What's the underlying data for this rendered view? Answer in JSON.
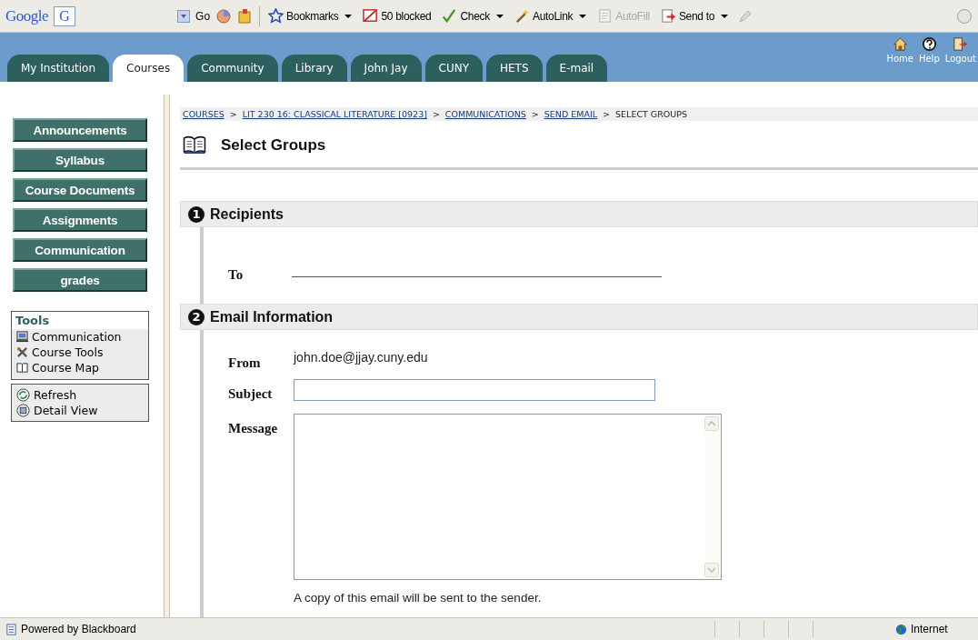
{
  "browser_toolbar": {
    "logo": "Google",
    "search_box": {
      "letter": "G"
    },
    "go": "Go",
    "items": [
      {
        "label": "Bookmarks",
        "kind": "star",
        "dropdown": true,
        "disabled": false
      },
      {
        "label": "50 blocked",
        "kind": "popup",
        "dropdown": false,
        "disabled": false
      },
      {
        "label": "Check",
        "kind": "spell",
        "dropdown": true,
        "disabled": false
      },
      {
        "label": "AutoLink",
        "kind": "wand",
        "dropdown": true,
        "disabled": false
      },
      {
        "label": "AutoFill",
        "kind": "form",
        "dropdown": false,
        "disabled": true
      },
      {
        "label": "Send to",
        "kind": "send",
        "dropdown": true,
        "disabled": false
      }
    ]
  },
  "tabs": [
    {
      "label": "My Institution",
      "selected": false
    },
    {
      "label": "Courses",
      "selected": true
    },
    {
      "label": "Community",
      "selected": false
    },
    {
      "label": "Library",
      "selected": false
    },
    {
      "label": "John Jay",
      "selected": false
    },
    {
      "label": "CUNY",
      "selected": false
    },
    {
      "label": "HETS",
      "selected": false
    },
    {
      "label": "E-mail",
      "selected": false
    }
  ],
  "header_links": [
    {
      "label": "Home",
      "kind": "home"
    },
    {
      "label": "Help",
      "kind": "help"
    },
    {
      "label": "Logout",
      "kind": "logout"
    }
  ],
  "course_menu": [
    "Announcements",
    "Syllabus",
    "Course Documents",
    "Assignments",
    "Communication",
    "grades"
  ],
  "tools": {
    "title": "Tools",
    "items": [
      {
        "label": "Communication",
        "kind": "computer"
      },
      {
        "label": "Course Tools",
        "kind": "tools"
      },
      {
        "label": "Course Map",
        "kind": "map"
      }
    ]
  },
  "view_links": [
    {
      "label": "Refresh",
      "kind": "refresh"
    },
    {
      "label": "Detail View",
      "kind": "detail"
    }
  ],
  "breadcrumb": [
    {
      "text": "COURSES",
      "kind": "link"
    },
    {
      "text": ">",
      "kind": "separator"
    },
    {
      "text": "LIT 230 16: CLASSICAL LITERATURE [0923]",
      "kind": "link"
    },
    {
      "text": ">",
      "kind": "separator"
    },
    {
      "text": "COMMUNICATIONS",
      "kind": "link"
    },
    {
      "text": ">",
      "kind": "separator"
    },
    {
      "text": "SEND EMAIL",
      "kind": "link"
    },
    {
      "text": ">",
      "kind": "separator"
    },
    {
      "text": "SELECT GROUPS",
      "kind": "current"
    }
  ],
  "page_title": "Select Groups",
  "sections": [
    {
      "number": "1",
      "title": "Recipients"
    },
    {
      "number": "2",
      "title": "Email Information"
    }
  ],
  "recipients": {
    "to_label": "To"
  },
  "email": {
    "from_label": "From",
    "from_value": "john.doe@jjay.cuny.edu",
    "subject_label": "Subject",
    "message_label": "Message",
    "note": "A copy of this email will be sent to the sender."
  },
  "status_bar": {
    "text": "Powered by Blackboard",
    "zone": "Internet"
  }
}
